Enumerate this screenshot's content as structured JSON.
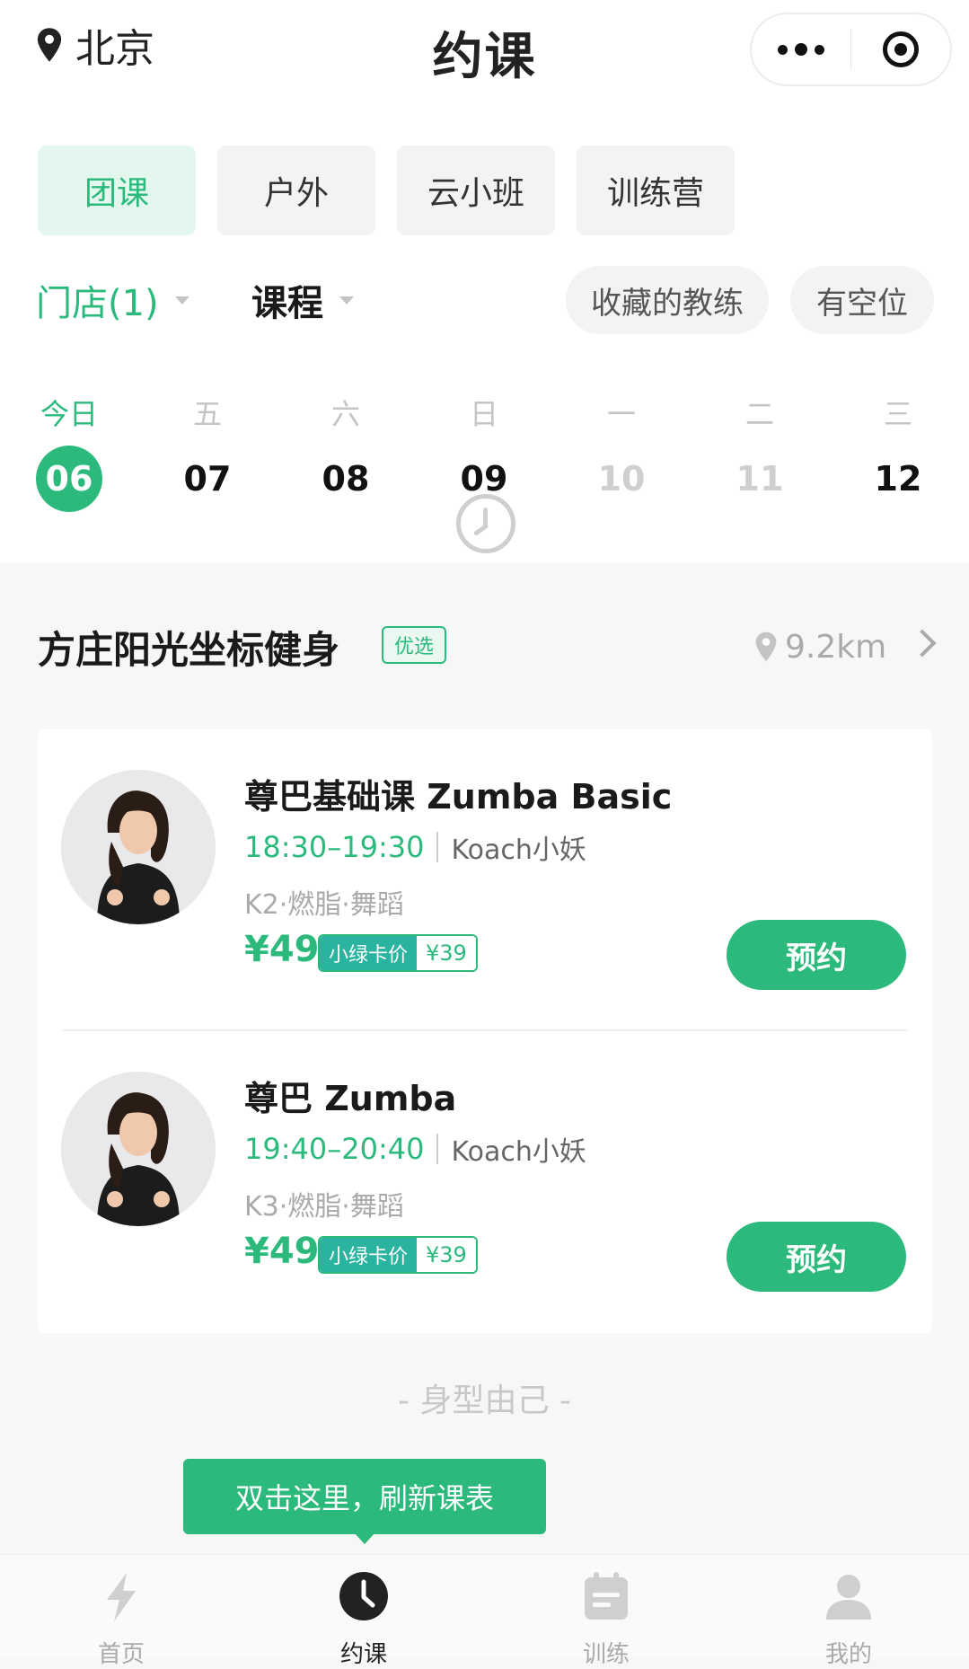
{
  "header": {
    "city": "北京",
    "title": "约课"
  },
  "categories": [
    {
      "label": "团课",
      "active": true
    },
    {
      "label": "户外",
      "active": false
    },
    {
      "label": "云小班",
      "active": false
    },
    {
      "label": "训练营",
      "active": false
    }
  ],
  "filters": {
    "store": "门店(1)",
    "course": "课程",
    "favorite_coaches": "收藏的教练",
    "available_spots": "有空位"
  },
  "dates": [
    {
      "weekday": "今日",
      "day": "06",
      "state": "selected"
    },
    {
      "weekday": "五",
      "day": "07",
      "state": "normal"
    },
    {
      "weekday": "六",
      "day": "08",
      "state": "normal"
    },
    {
      "weekday": "日",
      "day": "09",
      "state": "normal"
    },
    {
      "weekday": "一",
      "day": "10",
      "state": "disabled"
    },
    {
      "weekday": "二",
      "day": "11",
      "state": "disabled"
    },
    {
      "weekday": "三",
      "day": "12",
      "state": "normal"
    }
  ],
  "store": {
    "name": "方庄阳光坐标健身",
    "badge": "优选",
    "distance": "9.2km"
  },
  "courses": [
    {
      "name": "尊巴基础课 Zumba Basic",
      "time": "18:30–19:30",
      "coach": "Koach小妖",
      "tags": "K2·燃脂·舞蹈",
      "price": "¥49",
      "card_label": "小绿卡价",
      "card_price": "¥39",
      "book_label": "预约"
    },
    {
      "name": "尊巴 Zumba",
      "time": "19:40–20:40",
      "coach": "Koach小妖",
      "tags": "K3·燃脂·舞蹈",
      "price": "¥49",
      "card_label": "小绿卡价",
      "card_price": "¥39",
      "book_label": "预约"
    }
  ],
  "slogan": "- 身型由己 -",
  "toast": "双击这里，刷新课表",
  "tabbar": [
    {
      "label": "首页",
      "icon": "lightning-icon",
      "active": false
    },
    {
      "label": "约课",
      "icon": "clock-icon",
      "active": true
    },
    {
      "label": "训练",
      "icon": "calendar-icon",
      "active": false
    },
    {
      "label": "我的",
      "icon": "user-icon",
      "active": false
    }
  ],
  "colors": {
    "accent": "#2cba7c",
    "accent_light": "#e3f7ee",
    "card_label_bg": "#2ab4a0"
  }
}
